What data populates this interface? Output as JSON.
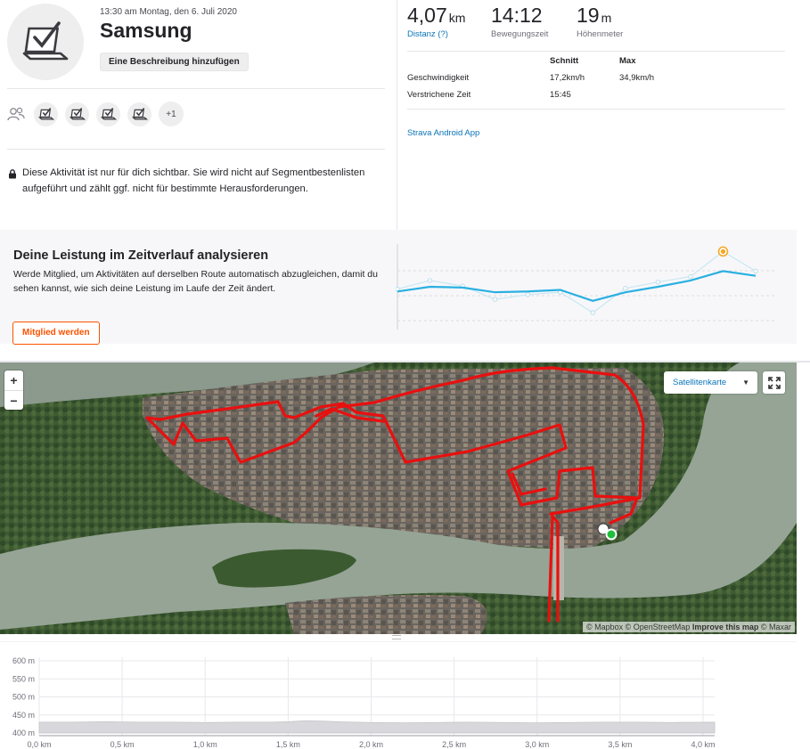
{
  "activity": {
    "datetime": "13:30 am Montag, den 6. Juli 2020",
    "title": "Samsung",
    "add_description": "Eine Beschreibung hinzufügen",
    "others_count": "+1",
    "privacy_notice": "Diese Aktivität ist nur für dich sichtbar. Sie wird nicht auf Segmentbestenlisten aufgeführt und zählt ggf. nicht für bestimmte Herausforderungen."
  },
  "stats": {
    "distance": {
      "value": "4,07",
      "unit": "km",
      "label": "Distanz (?)"
    },
    "moving_time": {
      "value": "14:12",
      "label": "Bewegungszeit"
    },
    "elevation": {
      "value": "19",
      "unit": "m",
      "label": "Höhenmeter"
    },
    "table": {
      "col_avg": "Schnitt",
      "col_max": "Max",
      "rows": [
        {
          "label": "Geschwindigkeit",
          "avg": "17,2km/h",
          "max": "34,9km/h"
        },
        {
          "label": "Verstrichene Zeit",
          "avg": "15:45",
          "max": ""
        }
      ]
    },
    "device": "Strava Android App"
  },
  "upsell": {
    "title": "Deine Leistung im Zeitverlauf analysieren",
    "text": "Werde Mitglied, um Aktivitäten auf derselben Route automatisch abzugleichen, damit du sehen kannst, wie sich deine Leistung im Laufe der Zeit ändert.",
    "button": "Mitglied werden"
  },
  "map": {
    "zoom_in": "+",
    "zoom_out": "−",
    "map_type": "Satellitenkarte",
    "attribution_mapbox": "© Mapbox",
    "attribution_osm": "© OpenStreetMap",
    "attribution_improve": "Improve this map",
    "attribution_maxar": "© Maxar"
  },
  "colors": {
    "strava_orange": "#fc5200",
    "link_blue": "#0a73b8",
    "route_red": "#e8100f",
    "trend_blue": "#2bb0e0",
    "elevation_fill": "#d8d8dc"
  },
  "chart_data": [
    {
      "type": "line",
      "title": "",
      "series": [
        {
          "values": [
            0.44,
            0.5,
            0.49,
            0.43,
            0.44,
            0.46,
            0.32,
            0.43,
            0.5,
            0.58,
            0.7,
            0.64
          ]
        },
        {
          "values": [
            0.47,
            0.58,
            0.51,
            0.34,
            0.4,
            0.43,
            0.17,
            0.48,
            0.56,
            0.63,
            0.95,
            0.7
          ]
        }
      ],
      "highlight_index": 10,
      "grid": true,
      "axis_labels": false
    },
    {
      "type": "area",
      "xlabel": "",
      "ylabel": "",
      "x_ticks": [
        "0,0 km",
        "0,5 km",
        "1,0 km",
        "1,5 km",
        "2,0 km",
        "2,5 km",
        "3,0 km",
        "3,5 km",
        "4,0 km"
      ],
      "y_ticks": [
        "400 m",
        "450 m",
        "500 m",
        "550 m",
        "600 m"
      ],
      "x": [
        0.0,
        0.2,
        0.4,
        0.6,
        0.8,
        1.0,
        1.2,
        1.4,
        1.5,
        1.6,
        1.7,
        1.8,
        2.0,
        2.2,
        2.4,
        2.6,
        2.8,
        3.0,
        3.2,
        3.4,
        3.6,
        3.8,
        4.07
      ],
      "y": [
        430,
        430,
        431,
        430,
        430,
        429,
        430,
        430,
        431,
        434,
        433,
        431,
        429,
        428,
        429,
        430,
        429,
        428,
        429,
        430,
        430,
        429,
        430
      ],
      "xlim": [
        0,
        4.07
      ],
      "ylim": [
        400,
        620
      ],
      "grid": true
    }
  ]
}
